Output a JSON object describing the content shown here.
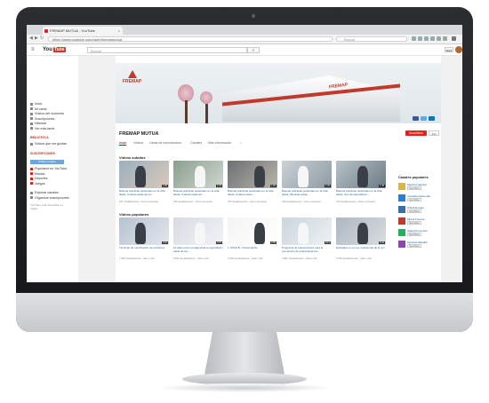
{
  "browser": {
    "tab_title": "FREMAP MUTUA - YouTube",
    "tab_close": "×",
    "url": "https://www.youtube.com/user/fremapmutua",
    "search_placeholder": "Buscar",
    "traffic_colors": [
      "#ff5f57",
      "#ffbd2e",
      "#28c940"
    ]
  },
  "youtube": {
    "logo_you": "You",
    "logo_tube": "Tube",
    "logo_suffix": "ES",
    "search_placeholder": "Buscar",
    "upload_label": "Subir",
    "hamburger_icon": "menu-icon"
  },
  "sidebar": {
    "items": [
      {
        "label": "Inicio",
        "icon": "home-icon"
      },
      {
        "label": "Mi canal",
        "icon": "user-icon"
      },
      {
        "label": "Vídeos del momento",
        "icon": "trending-icon"
      },
      {
        "label": "Suscripciones",
        "icon": "subscriptions-icon"
      },
      {
        "label": "Historial",
        "icon": "history-icon"
      },
      {
        "label": "Ver más tarde",
        "icon": "clock-icon"
      }
    ],
    "library_heading": "BIBLIOTECA",
    "library_items": [
      {
        "label": "Vídeos que me gustan",
        "icon": "like-icon"
      }
    ],
    "subs_heading": "SUSCRIPCIONES",
    "subs_button": "Añadir canales",
    "subs_items": [
      {
        "label": "Populares en YouTube",
        "color": "#e62117"
      },
      {
        "label": "Música",
        "color": "#e62117"
      },
      {
        "label": "Deportes",
        "color": "#e62117"
      },
      {
        "label": "Juegos",
        "color": "#e62117"
      }
    ],
    "footer_items": [
      {
        "label": "Explorar canales",
        "icon": "plus-icon"
      },
      {
        "label": "Organizar suscripciones",
        "icon": "gear-icon"
      }
    ],
    "footer_note": "YouTube está disponible en Inglés"
  },
  "channel": {
    "name": "FREMAP MUTUA",
    "banner_logo": "FREMAP",
    "building_sign": "FREMAP",
    "subscribe_label": "Suscribirse",
    "subscriber_count": "234",
    "tabs": [
      "Inicio",
      "Vídeos",
      "Listas de reproducción",
      "Canales",
      "Más información"
    ],
    "active_tab": 0,
    "social_colors": [
      "#3b5998",
      "#55acee",
      "#0077b5"
    ]
  },
  "sections": {
    "uploaded_title": "Vídeos subidos",
    "popular_title": "Vídeos populares",
    "uploaded": [
      {
        "title": "Buenas prácticas posturales en la vida diaria. Cuando estás de pie",
        "meta": "187 visualizaciones · hace 2 semanas",
        "duration": "1:28"
      },
      {
        "title": "Buenas prácticas posturales en la vida diaria. Cuando estás de...",
        "meta": "195 visualizaciones · hace 2 semanas",
        "duration": "1:41"
      },
      {
        "title": "Buenas prácticas posturales en la vida diaria. Cuando estés...",
        "meta": "275 visualizaciones · hace 2 semanas",
        "duration": "1:36"
      },
      {
        "title": "Buenas prácticas posturales en la vida diaria. Mientras estás...",
        "meta": "180 visualizaciones · hace 2 semanas",
        "duration": "1:32"
      },
      {
        "title": "Buenas prácticas posturales en la vida diaria. Uso de dispositivos...",
        "meta": "310 visualizaciones · hace 2 semanas",
        "duration": "1:48"
      }
    ],
    "popular": [
      {
        "title": "Técnicas de movilización de pacientes",
        "meta": "7.469 visualizaciones · hace 1 año",
        "duration": "4:21"
      },
      {
        "title": "10 años como protagonista la seguridad y salud de los...",
        "meta": "5.826 visualizaciones · hace 1 año",
        "duration": "3:37"
      },
      {
        "title": "1. ESVA B - Presentación",
        "meta": "4.230 visualizaciones · hace 1 año",
        "duration": "2:05"
      },
      {
        "title": "Programa de autocontroles para la prevención de sobreesfuerzos...",
        "meta": "3.981 visualizaciones · hace 1 año",
        "duration": "6:12"
      },
      {
        "title": "Entidades en el uso profesional de la voz",
        "meta": "3.105 visualizaciones · hace 1 año",
        "duration": "5:44"
      }
    ]
  },
  "popular_channels": {
    "title": "Canales populares",
    "subscribe_label": "Suscribirse",
    "items": [
      {
        "name": "MapFremapcast",
        "color": "#d9b44a"
      },
      {
        "name": "mutuafremapmedia",
        "color": "#2e7dd1"
      },
      {
        "name": "OSHA Europe",
        "color": "#3a6ea5"
      },
      {
        "name": "Mutua Fremap",
        "color": "#c0392b"
      },
      {
        "name": "SafetyPrevention",
        "color": "#27ae60"
      },
      {
        "name": "SportsAndHealth",
        "color": "#8e44ad"
      }
    ]
  }
}
